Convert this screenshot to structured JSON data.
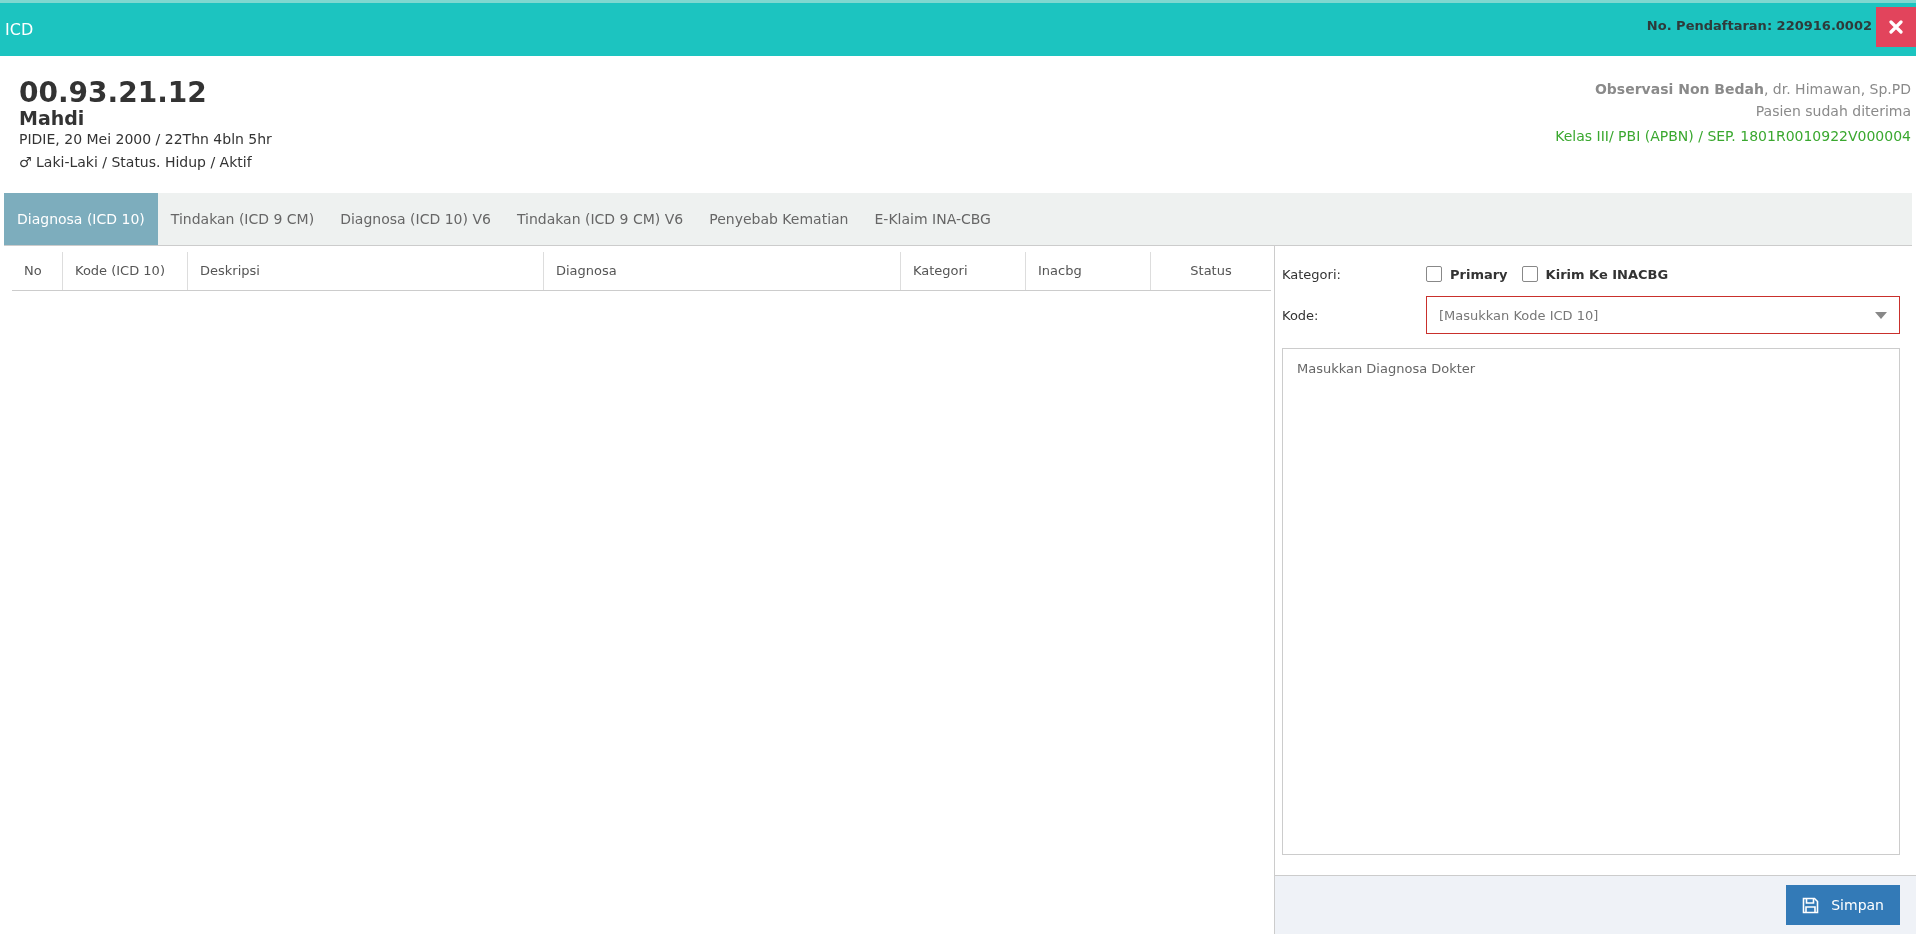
{
  "window": {
    "title": "ICD",
    "registration": "No. Pendaftaran: 220916.0002"
  },
  "patient": {
    "mrn": "00.93.21.12",
    "name": "Mahdi",
    "birth": "PIDIE, 20 Mei 2000 / 22Thn 4bln 5hr",
    "status": "♂ Laki-Laki / Status. Hidup / Aktif"
  },
  "visit": {
    "unit": "**Observasi Non Bedah**, dr. Himawan, Sp.PD",
    "state": "Pasien sudah diterima",
    "insurance": "Kelas III/ PBI (APBN) / SEP. 1801R0010922V000004"
  },
  "tabs": [
    {
      "label": "Diagnosa (ICD 10)",
      "selected": true
    },
    {
      "label": "Tindakan (ICD 9 CM)",
      "selected": false
    },
    {
      "label": "Diagnosa (ICD 10) V6",
      "selected": false
    },
    {
      "label": "Tindakan (ICD 9 CM) V6",
      "selected": false
    },
    {
      "label": "Penyebab Kematian",
      "selected": false
    },
    {
      "label": "E-Klaim INA-CBG",
      "selected": false
    }
  ],
  "table": {
    "columns": [
      "No",
      "Kode (ICD 10)",
      "Deskripsi",
      "Diagnosa",
      "Kategori",
      "Inacbg",
      "Status"
    ]
  },
  "form": {
    "kategori_label": "Kategori:",
    "checkboxes": [
      {
        "label": "Primary",
        "checked": false
      },
      {
        "label": "Kirim Ke INACBG",
        "checked": false
      }
    ],
    "kode_label": "Kode:",
    "kode": {
      "placeholder": "[Masukkan Kode ICD 10]"
    },
    "diagnosa": {
      "placeholder": "Masukkan Diagnosa Dokter"
    },
    "save": "Simpan"
  }
}
